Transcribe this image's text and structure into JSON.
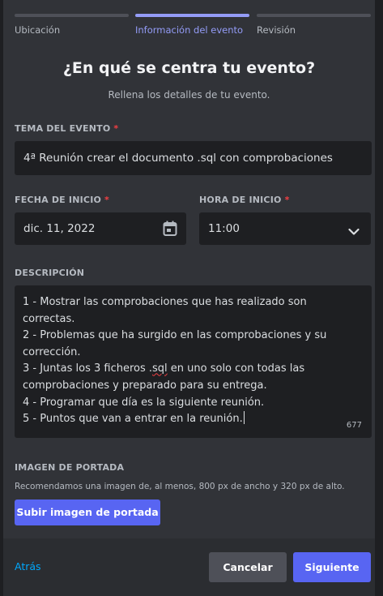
{
  "steps": [
    {
      "label": "Ubicación",
      "active": false
    },
    {
      "label": "Información del evento",
      "active": true
    },
    {
      "label": "Revisión",
      "active": false
    }
  ],
  "header": {
    "title": "¿En qué se centra tu evento?",
    "subtitle": "Rellena los detalles de tu evento."
  },
  "topic": {
    "label": "TEMA DEL EVENTO",
    "required_mark": "*",
    "value": "4ª Reunión crear el documento .sql con comprobaciones"
  },
  "start_date": {
    "label": "FECHA DE INICIO",
    "required_mark": "*",
    "value": "dic. 11, 2022",
    "icon": "calendar-icon"
  },
  "start_time": {
    "label": "HORA DE INICIO",
    "required_mark": "*",
    "value": "11:00",
    "icon": "chevron-down-icon"
  },
  "description": {
    "label": "DESCRIPCIÓN",
    "line1": "1 - Mostrar las comprobaciones que has realizado son correctas.",
    "line2": "2 - Problemas que ha surgido en las comprobaciones y su corrección.",
    "line3_pre": "3 - Juntas los 3 ficheros .",
    "line3_misspelled": "sql",
    "line3_post": " en uno solo con todas las comprobaciones y preparado para su entrega.",
    "line4": "4 - Programar que día es la siguiente reunión.",
    "line5": "5 - Puntos que van a entrar en la reunión.",
    "char_count": "677"
  },
  "cover": {
    "label": "IMAGEN DE PORTADA",
    "note": "Recomendamos una imagen de, al menos, 800 px de ancho y 320 px de alto.",
    "upload_label": "Subir imagen de portada"
  },
  "footer": {
    "back_label": "Atrás",
    "cancel_label": "Cancelar",
    "next_label": "Siguiente"
  },
  "colors": {
    "accent": "#5865f2",
    "active_step": "#949cf7",
    "required": "#f23f43",
    "link": "#00a8fc"
  }
}
